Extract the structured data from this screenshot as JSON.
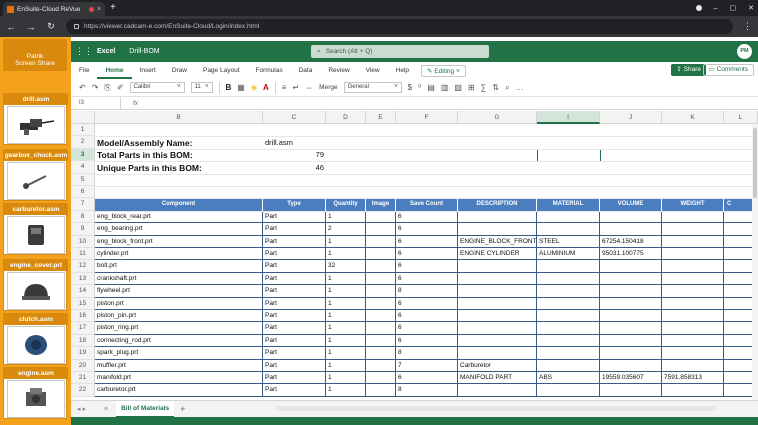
{
  "browser": {
    "tab_title": "EnSuite-Cloud ReVue",
    "tab_close": "×",
    "new_tab": "+",
    "back": "←",
    "forward": "→",
    "reload": "↻",
    "url": "https://viewer.cadcam-e.com/EnSuite-Cloud/Login/index.html",
    "menu": "⋮",
    "minimize": "–",
    "maximize": "▢",
    "close": "✕"
  },
  "sidebar": {
    "patrik_line1": "Patrik",
    "patrik_line2": "Screen Share",
    "items": [
      {
        "label": "drill.asm"
      },
      {
        "label": "gearbox_chuck.asm"
      },
      {
        "label": "carburetor.asm"
      },
      {
        "label": "engine_cover.prt"
      },
      {
        "label": "clutch.asm"
      },
      {
        "label": "engine.asm"
      }
    ]
  },
  "excel": {
    "app_name": "Excel",
    "doc_name": "Drill-BOM",
    "search_placeholder": "Search (Alt + Q)",
    "avatar": "PM",
    "tabs": [
      "File",
      "Home",
      "Insert",
      "Draw",
      "Page Layout",
      "Formulas",
      "Data",
      "Review",
      "View",
      "Help"
    ],
    "active_tab": "Home",
    "editing_label": "Editing",
    "share_label": "Share",
    "comments_label": "Comments",
    "font_name": "Calibri",
    "font_size": "11",
    "bold": "B",
    "merge_label": "Merge",
    "number_format": "General",
    "currency": "$",
    "namebox": "I3",
    "fx": "fx",
    "columns": [
      "B",
      "C",
      "D",
      "E",
      "F",
      "G",
      "I",
      "J",
      "K",
      "L"
    ],
    "selected_column": "I",
    "rows": [
      "1",
      "2",
      "3",
      "4",
      "5",
      "6",
      "7",
      "8",
      "9",
      "10",
      "11",
      "12",
      "13",
      "14",
      "15",
      "16",
      "17",
      "18",
      "19",
      "20",
      "21",
      "22"
    ],
    "selected_row": "3",
    "sheet_tab": "Bill of Materials",
    "sheet_add": "+"
  },
  "summary": {
    "model_label": "Model/Assembly Name:",
    "model_value": "drill.asm",
    "total_label": "Total Parts in this BOM:",
    "total_value": "79",
    "unique_label": "Unique Parts in this BOM:",
    "unique_value": "46"
  },
  "bom": {
    "headers": [
      "Component",
      "Type",
      "Quantity",
      "Image",
      "Save Count",
      "DESCRIPTION",
      "MATERIAL",
      "VOLUME",
      "WEIGHT",
      "C"
    ],
    "rows": [
      [
        "eng_block_rear.prt",
        "Part",
        "1",
        "",
        "6",
        "",
        "",
        "",
        ""
      ],
      [
        "eng_bearing.prt",
        "Part",
        "2",
        "",
        "6",
        "",
        "",
        "",
        ""
      ],
      [
        "eng_block_front.prt",
        "Part",
        "1",
        "",
        "6",
        "ENGINE_BLOCK_FRONT",
        "STEEL",
        "67254.150418",
        ""
      ],
      [
        "cylinder.prt",
        "Part",
        "1",
        "",
        "6",
        "ENGINE CYLINDER",
        "ALUMINIUM",
        "95031.100775",
        ""
      ],
      [
        "bolt.prt",
        "Part",
        "32",
        "",
        "6",
        "",
        "",
        "",
        ""
      ],
      [
        "crankshaft.prt",
        "Part",
        "1",
        "",
        "6",
        "",
        "",
        "",
        ""
      ],
      [
        "flywheel.prt",
        "Part",
        "1",
        "",
        "8",
        "",
        "",
        "",
        ""
      ],
      [
        "piston.prt",
        "Part",
        "1",
        "",
        "6",
        "",
        "",
        "",
        ""
      ],
      [
        "piston_pin.prt",
        "Part",
        "1",
        "",
        "6",
        "",
        "",
        "",
        ""
      ],
      [
        "piston_ring.prt",
        "Part",
        "1",
        "",
        "6",
        "",
        "",
        "",
        ""
      ],
      [
        "connecting_rod.prt",
        "Part",
        "1",
        "",
        "6",
        "",
        "",
        "",
        ""
      ],
      [
        "spark_plug.prt",
        "Part",
        "1",
        "",
        "8",
        "",
        "",
        "",
        ""
      ],
      [
        "muffler.prt",
        "Part",
        "1",
        "",
        "7",
        "Carburetor",
        "",
        "",
        ""
      ],
      [
        "manifold.prt",
        "Part",
        "1",
        "",
        "6",
        "MANIFOLD PART",
        "ABS",
        "19559.035607",
        "7591.858313"
      ],
      [
        "carburetor.prt",
        "Part",
        "1",
        "",
        "8",
        "",
        "",
        "",
        ""
      ]
    ]
  },
  "colors": {
    "excel_green": "#217346",
    "sidebar_orange": "#f4a21c",
    "table_header_blue": "#4a7ebf"
  }
}
